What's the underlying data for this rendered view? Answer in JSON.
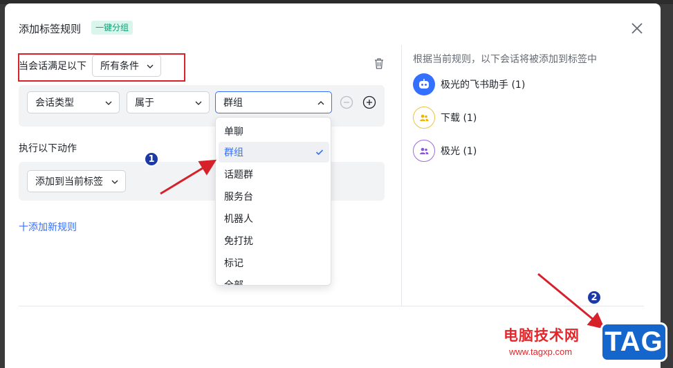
{
  "dialog": {
    "title": "添加标签规则",
    "badge": "一键分组"
  },
  "condition": {
    "label": "当会话满足以下",
    "select_value": "所有条件"
  },
  "rule": {
    "field": "会话类型",
    "operator": "属于",
    "value": "群组"
  },
  "dropdown": {
    "options": [
      "单聊",
      "群组",
      "话题群",
      "服务台",
      "机器人",
      "免打扰",
      "标记",
      "全部"
    ],
    "selected": "群组"
  },
  "action": {
    "label": "执行以下动作",
    "select_value": "添加到当前标签"
  },
  "add_rule_label": "十添加新规则",
  "preview": {
    "heading": "根据当前规则，以下会话将被添加到标签中",
    "chats": [
      {
        "name": "极光的飞书助手 (1)",
        "icon": "bot-icon"
      },
      {
        "name": "下载 (1)",
        "icon": "group-icon"
      },
      {
        "name": "极光 (1)",
        "icon": "group-icon"
      }
    ]
  },
  "annotations": {
    "step1": "1",
    "step2": "2"
  },
  "watermark": {
    "site_name": "电脑技术网",
    "url": "www.tagxp.com",
    "tag": "TAG"
  },
  "colors": {
    "accent": "#3370ff",
    "highlight_box": "#d6202a",
    "badge_bg": "#d9f5ec",
    "badge_text": "#0f9f74"
  }
}
